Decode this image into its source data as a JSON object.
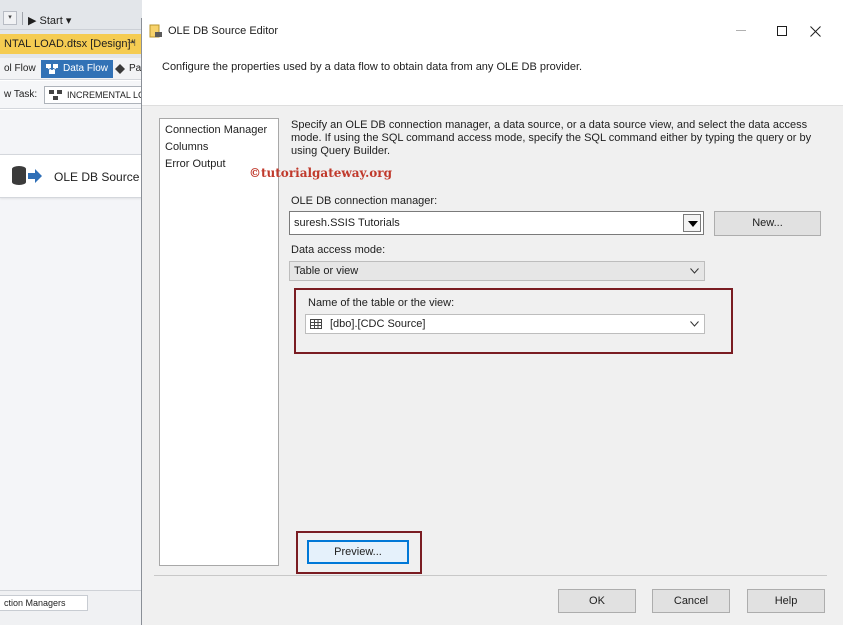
{
  "background_app": {
    "toolbar": {
      "start_label": "Start",
      "dropdown_glyph": "▾",
      "play_glyph": "▶"
    },
    "document_tab": {
      "label": "NTAL LOAD.dtsx [Design]*",
      "pin_glyph": "⊣"
    },
    "design_tabs": {
      "control_flow": "ol Flow",
      "data_flow": "Data Flow",
      "parameters": "Pa"
    },
    "task_selector": {
      "label": "w Task:",
      "value": "INCREMENTAL LC"
    },
    "component": {
      "label": "OLE DB Source",
      "icon": "ole-db-source-icon"
    },
    "bottom_tab": {
      "label": "ction Managers"
    }
  },
  "dialog": {
    "title": "OLE DB Source Editor",
    "title_icon": "ole-db-editor-icon",
    "description": "Configure the properties used by a data flow to obtain data from any OLE DB provider.",
    "nav": {
      "items": [
        {
          "label": "Connection Manager"
        },
        {
          "label": "Columns"
        },
        {
          "label": "Error Output"
        }
      ]
    },
    "info": "Specify an OLE DB connection manager, a data source, or a data source view, and select the data access mode. If using the SQL command access mode, specify the SQL command either by typing the query or by using Query Builder.",
    "watermark": "©tutorialgateway.org",
    "connection": {
      "label": "OLE DB connection manager:",
      "value": "suresh.SSIS Tutorials",
      "new_button": "New..."
    },
    "access_mode": {
      "label": "Data access mode:",
      "value": "Table or view"
    },
    "table": {
      "label": "Name of the table or the view:",
      "value": "[dbo].[CDC Source]"
    },
    "buttons": {
      "preview": "Preview...",
      "ok": "OK",
      "cancel": "Cancel",
      "help": "Help"
    },
    "highlight_color": "#7a1c22",
    "focus_color": "#0078d7"
  }
}
